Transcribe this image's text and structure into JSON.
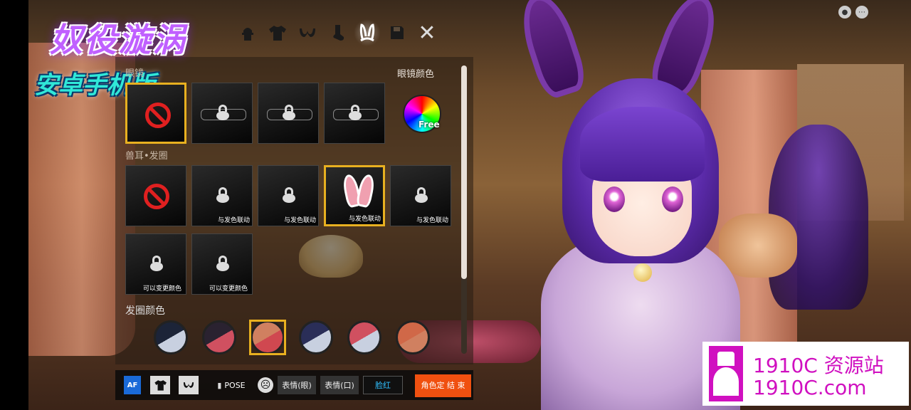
{
  "logo": {
    "title": "奴役漩涡",
    "subtitle": "安卓手机版"
  },
  "toolbar": {
    "icons": [
      "hat-icon",
      "shirt-icon",
      "bra-icon",
      "sock-icon",
      "bunny-ears-icon",
      "save-icon",
      "close-icon"
    ],
    "active": "bunny-ears-icon",
    "close_glyph": "✕"
  },
  "glasses_section": {
    "label": "眼镜",
    "color_label": "眼镜颜色",
    "free_label": "Free"
  },
  "ears_section": {
    "label": "兽耳•发圈",
    "captions": [
      "",
      "与发色联动",
      "与发色联动",
      "与发色联动",
      "与发色联动"
    ],
    "captions_row2": [
      "可以变更颜色",
      "可以变更颜色"
    ]
  },
  "hair_color_section": {
    "label": "发圈颜色",
    "swatches": [
      {
        "a": "#1c2438",
        "b": "#c8d0e0"
      },
      {
        "a": "#2a2230",
        "b": "#d05060"
      },
      {
        "a": "#d08060",
        "b": "#d04850"
      },
      {
        "a": "#2a2e58",
        "b": "#c8d0e0"
      },
      {
        "a": "#d05060",
        "b": "#c8d0e0"
      },
      {
        "a": "#d06848",
        "b": "#d08060"
      }
    ],
    "selected_index": 2
  },
  "bottom": {
    "af": "AF",
    "pose": "POSE",
    "expr_eye": "表情(眼)",
    "expr_mouth": "表情(口)",
    "blush": "脸红",
    "finish": "角色定 结 束"
  },
  "watermark": {
    "line1": "1910C 资源站",
    "line2": "1910C.com"
  },
  "colors": {
    "accent": "#e8b020",
    "finish": "#f05010",
    "brand": "#d010c0"
  }
}
